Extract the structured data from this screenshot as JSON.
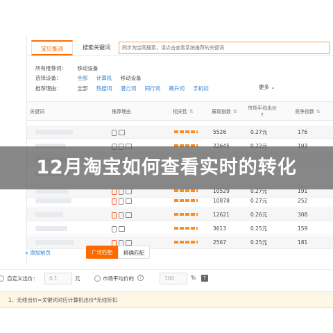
{
  "tabs": {
    "active": "宝贝推词",
    "keyword": "搜索关键词"
  },
  "search": {
    "placeholder": "同步淘宝网搜索，请点击查看系统推荐的关键词"
  },
  "filters": {
    "recommend_label": "所有推荐词：",
    "recommend_value": "移动设备",
    "device_label": "选择设备：",
    "device_options": [
      "全部",
      "计算机",
      "移动设备"
    ],
    "reason_label": "推荐理由：",
    "reason_options": [
      "全部",
      "热搜词",
      "潜力词",
      "同行词",
      "飙升词",
      "手机标"
    ],
    "more": "更多"
  },
  "table": {
    "headers": {
      "keyword": "关键词",
      "reason": "推荐理由",
      "relevance": "相关性",
      "impressions": "展现指数",
      "avg_bid_line1": "市场平均出价",
      "avg_bid_line2": "↑",
      "competition": "竞争指数"
    },
    "rows": [
      {
        "impressions": "5526",
        "bid": "0.27元",
        "comp": "176"
      },
      {
        "impressions": "22645",
        "bid": "0.22元",
        "comp": "193"
      },
      {
        "impressions": "",
        "bid": "",
        "comp": ""
      },
      {
        "impressions": "",
        "bid": "",
        "comp": ""
      },
      {
        "impressions": "10529",
        "bid": "0.27元",
        "comp": "191"
      },
      {
        "impressions": "10878",
        "bid": "0.27元",
        "comp": "252"
      },
      {
        "impressions": "12621",
        "bid": "0.26元",
        "comp": "308"
      },
      {
        "impressions": "3613",
        "bid": "0.25元",
        "comp": "159"
      },
      {
        "impressions": "2567",
        "bid": "0.25元",
        "comp": "181"
      }
    ]
  },
  "banner": {
    "title": "12月淘宝如何查看实时的转化"
  },
  "pager": {
    "add_prev": "添加前页"
  },
  "match": {
    "broad": "广泛匹配",
    "exact": "精确匹配"
  },
  "bid": {
    "custom_label": "自定义出价：",
    "custom_value": "0.1",
    "custom_unit": "元",
    "market_label": "市场平均价的",
    "market_value": "100",
    "market_unit": "%"
  },
  "tip": {
    "text": "1、无线出价=关键词对应计算机出价*无线折扣"
  },
  "colors": {
    "accent": "#ff6a00",
    "link": "#2f7fd8",
    "banner": "#5a5a5a"
  }
}
